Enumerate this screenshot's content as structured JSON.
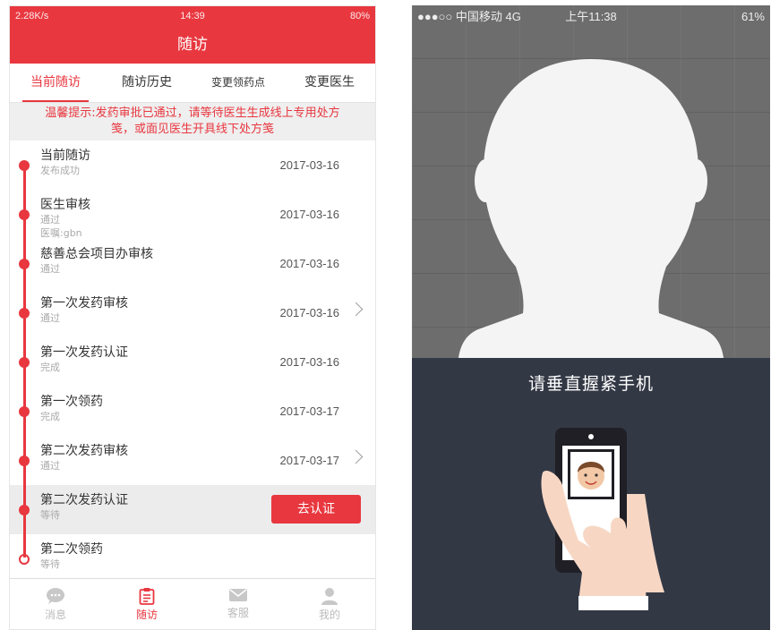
{
  "left_phone": {
    "status": {
      "signal_speed": "2.28K/s",
      "time": "14:39",
      "battery": "80%"
    },
    "title": "随访",
    "tabs": [
      "当前随访",
      "随访历史",
      "变更领药点",
      "变更医生"
    ],
    "notice": {
      "line1": "温馨提示:发药审批已通过，请等待医生生成线上专用处方",
      "line2": "笺，或面见医生开具线下处方笺"
    },
    "timeline": [
      {
        "title": "当前随访",
        "status": "发布成功",
        "date": "2017-03-16"
      },
      {
        "title": "医生审核",
        "status": "通过",
        "note": "医嘱:gbn",
        "date": "2017-03-16"
      },
      {
        "title": "慈善总会项目办审核",
        "status": "通过",
        "date": "2017-03-16"
      },
      {
        "title": "第一次发药审核",
        "status": "通过",
        "date": "2017-03-16",
        "has_arrow": true
      },
      {
        "title": "第一次发药认证",
        "status": "完成",
        "date": "2017-03-16"
      },
      {
        "title": "第一次领药",
        "status": "完成",
        "date": "2017-03-17"
      },
      {
        "title": "第二次发药审核",
        "status": "通过",
        "date": "2017-03-17",
        "has_arrow": true
      },
      {
        "title": "第二次发药认证",
        "status": "等待",
        "action": "去认证"
      },
      {
        "title": "第二次领药",
        "status": "等待"
      }
    ],
    "bottom_nav": [
      "消息",
      "随访",
      "客服",
      "我的"
    ],
    "accent_color": "#e8373f"
  },
  "right_phone": {
    "status": {
      "carrier": "●●●○○ 中国移动  4G",
      "time": "上午11:38",
      "battery": "61%"
    },
    "prompt": "请垂直握紧手机",
    "background_color": "#333845"
  }
}
